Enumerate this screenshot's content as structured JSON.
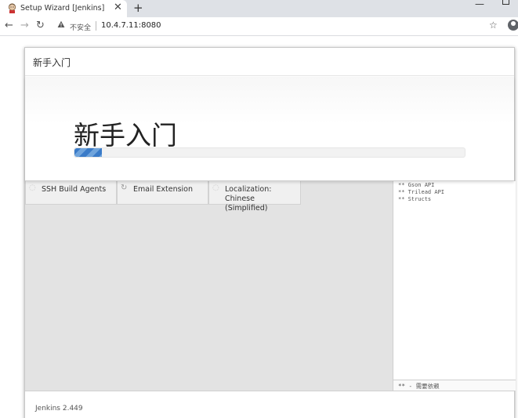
{
  "browser": {
    "tab_title": "Setup Wizard [Jenkins]",
    "tab_close": "✕",
    "new_tab": "+",
    "win_min": "—",
    "nav_back": "←",
    "nav_forward": "→",
    "nav_reload": "↻",
    "security_icon": "warning-triangle-icon",
    "security_label": "不安全",
    "url": "10.4.7.11:8080",
    "bookmark": "☆"
  },
  "modal": {
    "header_title": "新手入门",
    "hero_title": "新手入门",
    "progress_fraction": 0.07,
    "progress_color": "#3a7bc8",
    "plugins": [
      {
        "name": "SSH Build Agents",
        "status_icon": "pending-circle-icon"
      },
      {
        "name": "Email Extension",
        "status_icon": "refresh-spinner-icon"
      },
      {
        "name": "Localization: Chinese (Simplified)",
        "status_icon": "pending-circle-icon"
      }
    ],
    "log_lines": [
      "** Gson API",
      "** Trilead API",
      "** Structs"
    ],
    "log_footer": "** - 需要依赖",
    "version": "Jenkins 2.449"
  }
}
